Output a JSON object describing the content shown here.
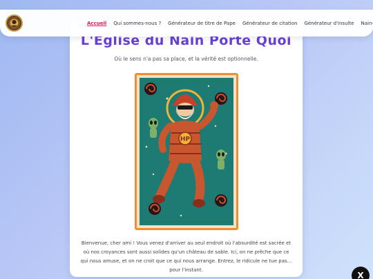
{
  "nav": {
    "items": [
      {
        "label": "Accueil",
        "active": true
      },
      {
        "label": "Qui sommes-nous ?",
        "active": false
      },
      {
        "label": "Générateur de titre de Pape",
        "active": false
      },
      {
        "label": "Générateur de citation",
        "active": false
      },
      {
        "label": "Générateur d'insulte",
        "active": false
      },
      {
        "label": "Nain-Clusive",
        "active": false
      }
    ],
    "active_color": "#e3165b"
  },
  "header": {
    "title": "L'Eglise du Nain Porte Quoi",
    "subtitle": "Où le sens n'a pas sa place, et la vérité est optionnelle."
  },
  "poster": {
    "badge_text": "HP",
    "frame_color": "#ef8d35",
    "background_color": "#1e7b74"
  },
  "intro": {
    "text": "Bienvenue, cher ami ! Vous venez d'arriver au seul endroit où l'absurdité est sacrée et où nos croyances sont aussi solides qu'un château de sable. Ici, on ne prêche que ce qui nous amuse, et on ne croit que ce qui nous arrange. Entrez, le ridicule ne tue pas... pour l'instant."
  },
  "social": {
    "icon": "x-icon",
    "label": "X"
  }
}
